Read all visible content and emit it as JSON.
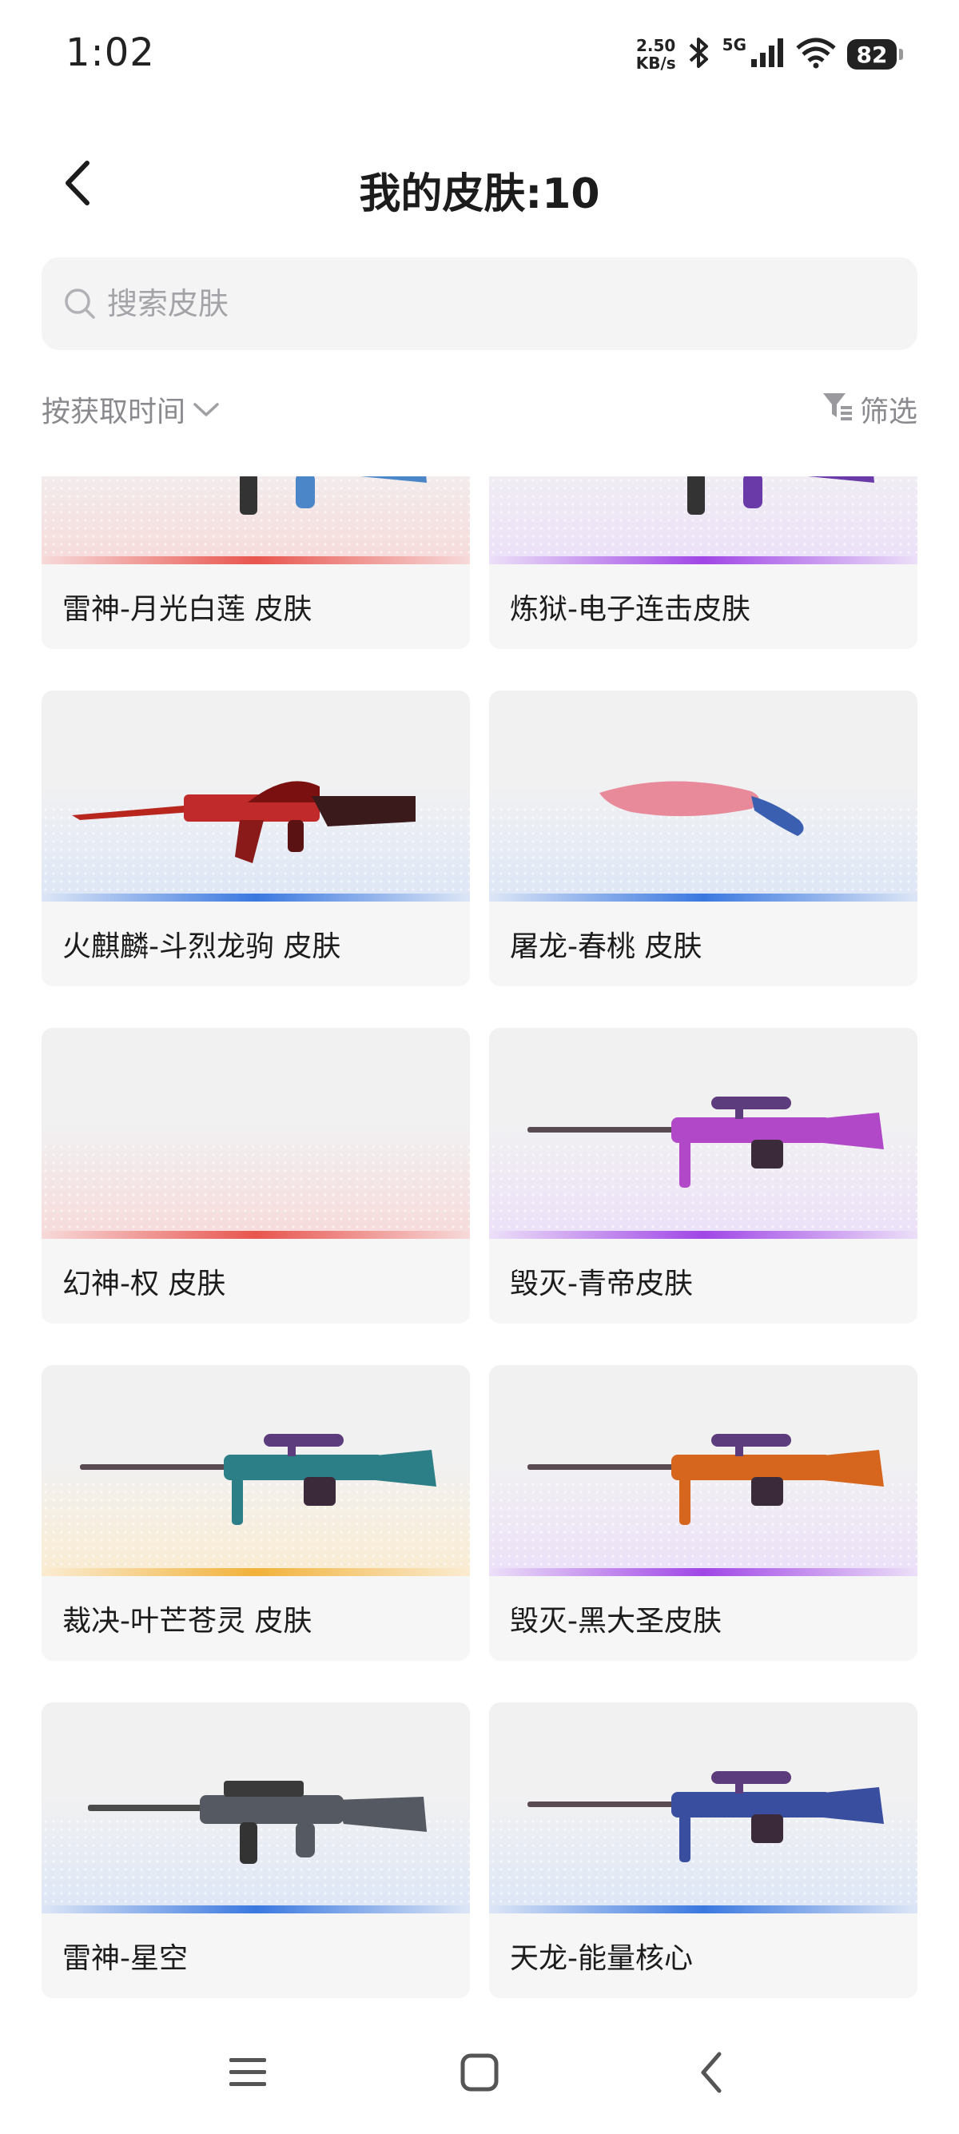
{
  "status_bar": {
    "time": "1:02",
    "net_speed_value": "2.50",
    "net_speed_unit": "KB/s",
    "network_type": "5G",
    "battery": "82"
  },
  "header": {
    "title": "我的皮肤:10"
  },
  "search": {
    "placeholder": "搜索皮肤"
  },
  "toolbar": {
    "sort_label": "按获取时间",
    "filter_label": "筛选"
  },
  "skins": [
    {
      "name": "雷神-月光白莲 皮肤",
      "rarity_color": "#e8554e",
      "tint": "#f7dada",
      "gun": "rifle",
      "gun_color": "#4b86c8"
    },
    {
      "name": "炼狱-电子连击皮肤",
      "rarity_color": "#a046e6",
      "tint": "#ece0f8",
      "gun": "rifle",
      "gun_color": "#6a3aa8"
    },
    {
      "name": "火麒麟-斗烈龙驹 皮肤",
      "rarity_color": "#3a78e0",
      "tint": "#dde6f6",
      "gun": "ak",
      "gun_color": "#c02a2a"
    },
    {
      "name": "屠龙-春桃 皮肤",
      "rarity_color": "#3a78e0",
      "tint": "#dde6f6",
      "gun": "knife",
      "gun_color": "#e88a9a"
    },
    {
      "name": "幻神-权 皮肤",
      "rarity_color": "#e8554e",
      "tint": "#f7dada",
      "gun": "none",
      "gun_color": "#cccccc"
    },
    {
      "name": "毁灭-青帝皮肤",
      "rarity_color": "#a046e6",
      "tint": "#ece0f8",
      "gun": "sniper",
      "gun_color": "#b048c8"
    },
    {
      "name": "裁决-叶芒苍灵 皮肤",
      "rarity_color": "#f2b23a",
      "tint": "#faecd2",
      "gun": "sniper",
      "gun_color": "#2c7f86"
    },
    {
      "name": "毁灭-黑大圣皮肤",
      "rarity_color": "#a046e6",
      "tint": "#ece0f8",
      "gun": "sniper",
      "gun_color": "#d6651e"
    },
    {
      "name": "雷神-星空",
      "rarity_color": "#3a78e0",
      "tint": "#dde6f6",
      "gun": "rifle",
      "gun_color": "#555a62"
    },
    {
      "name": "天龙-能量核心",
      "rarity_color": "#3a78e0",
      "tint": "#dde6f6",
      "gun": "sniper",
      "gun_color": "#3a4ea0"
    }
  ]
}
